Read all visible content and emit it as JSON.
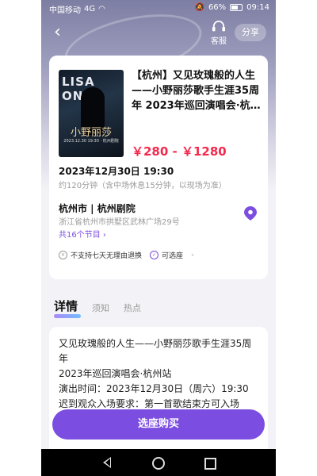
{
  "status_bar": {
    "carrier": "中国移动",
    "signal": "4G",
    "wifi": "wifi-icon",
    "battery": "66%",
    "time": "09:14"
  },
  "header": {
    "service_label": "客服",
    "share_label": "分享"
  },
  "event": {
    "poster": {
      "top_text": "LISA ONO",
      "title_text": "小野丽莎",
      "sub_text": "2023.12.30 19:30 · 杭州剧院"
    },
    "title": "【杭州】又见玫瑰般的人生——小野丽莎歌手生涯35周年 2023年巡回演唱会·杭…",
    "price": "￥280 - ￥1280",
    "datetime": "2023年12月30日 19:30",
    "duration": "约120分钟（含中场休息15分钟，以现场为准）",
    "venue": "杭州市 | 杭州剧院",
    "address": "浙江省杭州市拱墅区武林广场29号",
    "sessions": "共16个节目",
    "policy": [
      "不支持七天无理由退换",
      "可选座"
    ]
  },
  "tabs": [
    "详情",
    "须知",
    "热点"
  ],
  "details": [
    "又见玫瑰般的人生——小野丽莎歌手生涯35周",
    "年",
    "2023年巡回演唱会·杭州站",
    "演出时间：2023年12月30日（周六）19:30",
    "迟到观众入场要求：第一首歌结束方可入场"
  ],
  "buy_button": "选座购买",
  "colors": {
    "accent": "#7b4de0",
    "price": "#f5284c"
  }
}
